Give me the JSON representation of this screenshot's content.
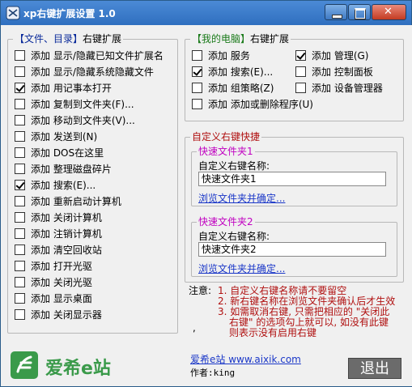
{
  "window": {
    "title": "xp右键扩展设置 1.0"
  },
  "left_group": {
    "bracket_open": "【",
    "title_blue": "文件、目录",
    "bracket_close": "】",
    "title_rest": "右键扩展",
    "items": [
      {
        "label": "添加 显示/隐藏已知文件扩展名",
        "checked": false
      },
      {
        "label": "添加 显示/隐藏系统隐藏文件",
        "checked": false
      },
      {
        "label": "添加 用记事本打开",
        "checked": true
      },
      {
        "label": "添加 复制到文件夹(F)...",
        "checked": false
      },
      {
        "label": "添加 移动到文件夹(V)...",
        "checked": false
      },
      {
        "label": "添加 发送到(N)",
        "checked": false
      },
      {
        "label": "添加 DOS在这里",
        "checked": false
      },
      {
        "label": "添加 整理磁盘碎片",
        "checked": false
      },
      {
        "label": "添加 搜索(E)...",
        "checked": true
      },
      {
        "label": "添加 重新启动计算机",
        "checked": false
      },
      {
        "label": "添加 关闭计算机",
        "checked": false
      },
      {
        "label": "添加 注销计算机",
        "checked": false
      },
      {
        "label": "添加 清空回收站",
        "checked": false
      },
      {
        "label": "添加 打开光驱",
        "checked": false
      },
      {
        "label": "添加 关闭光驱",
        "checked": false
      },
      {
        "label": "添加 显示桌面",
        "checked": false
      },
      {
        "label": "添加 关闭显示器",
        "checked": false
      }
    ]
  },
  "right_group": {
    "bracket_open": "【",
    "title_green": "我的电脑",
    "bracket_close": "】",
    "title_rest": "右键扩展",
    "items": [
      {
        "label": "添加 服务",
        "checked": false
      },
      {
        "label": "添加 管理(G)",
        "checked": true
      },
      {
        "label": "添加 搜索(E)...",
        "checked": true
      },
      {
        "label": "添加 控制面板",
        "checked": false
      },
      {
        "label": "添加 组策略(Z)",
        "checked": false
      },
      {
        "label": "添加 设备管理器",
        "checked": false
      },
      {
        "label": "添加 添加或删除程序(U)",
        "checked": false
      }
    ]
  },
  "custom_group": {
    "title": "自定义右键快捷",
    "folder1": {
      "title": "快速文件夹1",
      "name_label": "自定义右键名称:",
      "name_value": "快速文件夹1",
      "browse_link": "浏览文件夹并确定..."
    },
    "folder2": {
      "title": "快速文件夹2",
      "name_label": "自定义右键名称:",
      "name_value": "快速文件夹2",
      "browse_link": "浏览文件夹并确定..."
    }
  },
  "notes": {
    "prefix": "注意:",
    "line1": "1. 自定义右键名称请不要留空",
    "line2": "2. 新右键名称在浏览文件夹确认后才生效",
    "line3": "3. 如需取消右键, 只需把相应的 \"关闭此",
    "line4": "右键\" 的选项勾上就可以, 如没有此键",
    "line5": "则表示没有启用右键",
    "stray": ","
  },
  "footer": {
    "logo_text": "爱希e站",
    "site_link": "爱希e站 www.aixik.com",
    "author": "作者:king",
    "exit_label": "退出"
  },
  "colors": {
    "title_bar": "#2f6fbf",
    "accent_blue": "#0a2a9a",
    "accent_green": "#1a7a1a",
    "note_red": "#b01010",
    "link_blue": "#1a37c8",
    "logo_green": "#3a9a4a"
  }
}
